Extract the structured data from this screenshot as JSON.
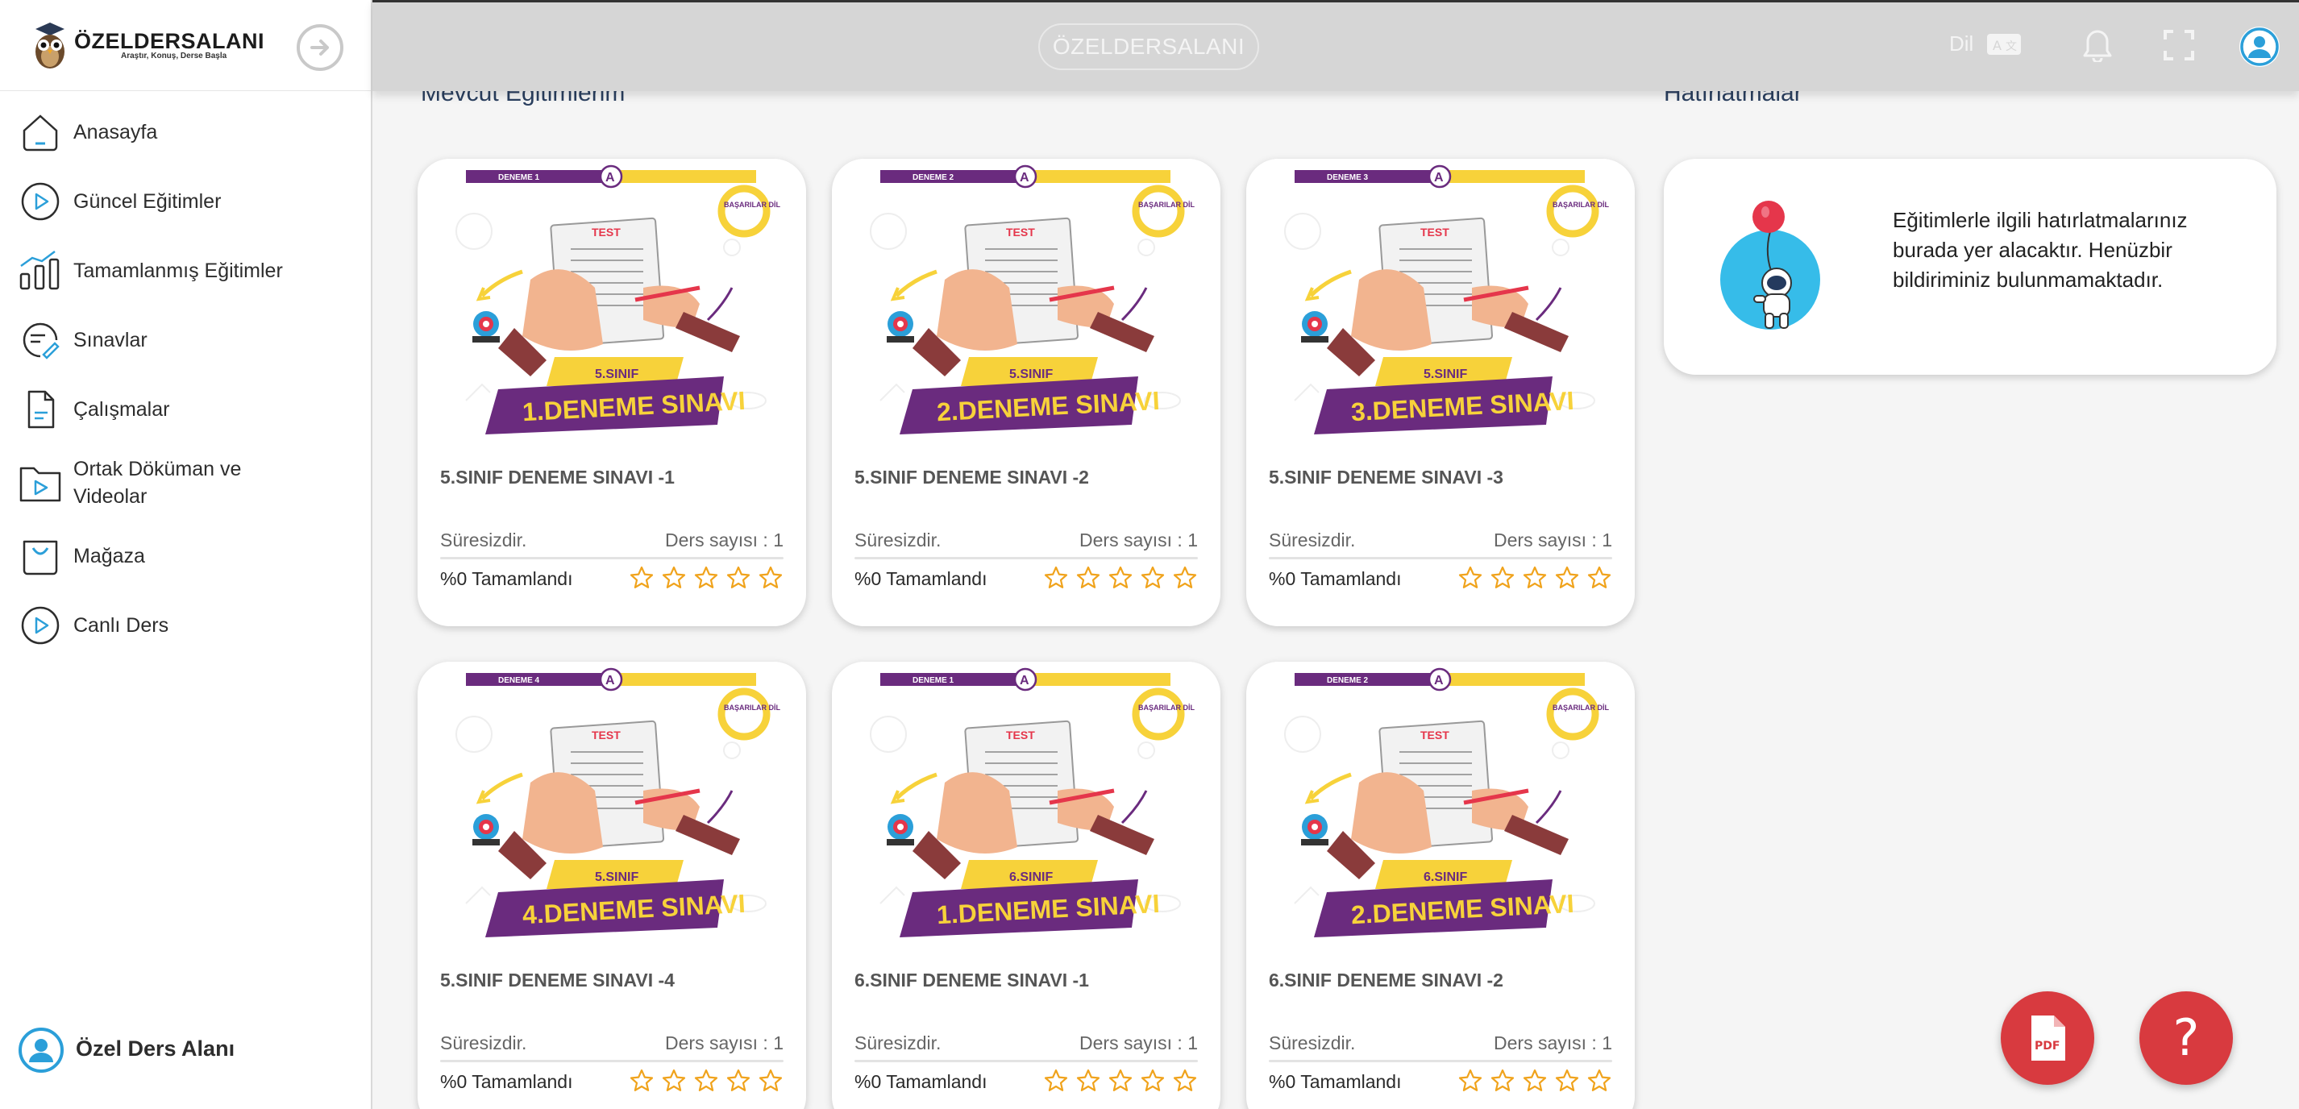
{
  "app": {
    "logo_title": "ÖZELDERSALANI",
    "logo_tagline": "Araştır, Konuş, Derse Başla",
    "brand_pill": "ÖZELDERSALANI"
  },
  "topbar": {
    "language_label": "Dil"
  },
  "sidebar": {
    "items": [
      {
        "label": "Anasayfa",
        "icon": "home-icon"
      },
      {
        "label": "Güncel Eğitimler",
        "icon": "play-circle-icon"
      },
      {
        "label": "Tamamlanmış Eğitimler",
        "icon": "bar-chart-icon"
      },
      {
        "label": "Sınavlar",
        "icon": "exam-icon"
      },
      {
        "label": "Çalışmalar",
        "icon": "document-icon"
      },
      {
        "label": "Ortak Döküman ve Videolar",
        "icon": "folder-play-icon"
      },
      {
        "label": "Mağaza",
        "icon": "shopping-bag-icon"
      },
      {
        "label": "Canlı Ders",
        "icon": "play-circle-icon"
      }
    ],
    "user_name": "Özel Ders Alanı"
  },
  "main": {
    "education_title": "Mevcut Eğitimlerim",
    "reminders_title": "Hatırlatmalar",
    "reminder_text": "Eğitimlerle ilgili hatırlatmalarınız burada yer alacaktır. Henüzbir bildiriminiz bulunmamaktadır.",
    "cards": [
      {
        "title": "5.SINIF DENEME SINAVI -1",
        "duration": "Süresizdir.",
        "lessons": "Ders sayısı : 1",
        "progress": "%0 Tamamlandı",
        "rating": 0,
        "img_top": "DENEME 1",
        "img_grade": "5.SINIF",
        "img_banner": "1.DENEME SINAVI",
        "img_badge": "A",
        "img_test": "TEST",
        "img_cloud": "BAŞARILAR DİLERİZ!"
      },
      {
        "title": "5.SINIF DENEME SINAVI -2",
        "duration": "Süresizdir.",
        "lessons": "Ders sayısı : 1",
        "progress": "%0 Tamamlandı",
        "rating": 0,
        "img_top": "DENEME 2",
        "img_grade": "5.SINIF",
        "img_banner": "2.DENEME SINAVI",
        "img_badge": "A",
        "img_test": "TEST",
        "img_cloud": "BAŞARILAR DİLERİZ!"
      },
      {
        "title": "5.SINIF DENEME SINAVI -3",
        "duration": "Süresizdir.",
        "lessons": "Ders sayısı : 1",
        "progress": "%0 Tamamlandı",
        "rating": 0,
        "img_top": "DENEME 3",
        "img_grade": "5.SINIF",
        "img_banner": "3.DENEME SINAVI",
        "img_badge": "A",
        "img_test": "TEST",
        "img_cloud": "BAŞARILAR DİLERİZ!"
      },
      {
        "title": "5.SINIF DENEME SINAVI -4",
        "duration": "Süresizdir.",
        "lessons": "Ders sayısı : 1",
        "progress": "%0 Tamamlandı",
        "rating": 0,
        "img_top": "DENEME 4",
        "img_grade": "5.SINIF",
        "img_banner": "4.DENEME SINAVI",
        "img_badge": "A",
        "img_test": "TEST",
        "img_cloud": "BAŞARILAR DİLERİZ!"
      },
      {
        "title": "6.SINIF DENEME SINAVI -1",
        "duration": "Süresizdir.",
        "lessons": "Ders sayısı : 1",
        "progress": "%0 Tamamlandı",
        "rating": 0,
        "img_top": "DENEME 1",
        "img_grade": "6.SINIF",
        "img_banner": "1.DENEME SINAVI",
        "img_badge": "A",
        "img_test": "TEST",
        "img_cloud": "BAŞARILAR DİLERİZ!"
      },
      {
        "title": "6.SINIF DENEME SINAVI -2",
        "duration": "Süresizdir.",
        "lessons": "Ders sayısı : 1",
        "progress": "%0 Tamamlandı",
        "rating": 0,
        "img_top": "DENEME 2",
        "img_grade": "6.SINIF",
        "img_banner": "2.DENEME SINAVI",
        "img_badge": "A",
        "img_test": "TEST",
        "img_cloud": "BAŞARILAR DİLERİZ!"
      }
    ]
  },
  "fabs": {
    "pdf_label": "PDF",
    "help_label": "?"
  },
  "colors": {
    "accent_blue": "#2b9fd9",
    "purple": "#6a2b7e",
    "yellow": "#f7d23a",
    "star_orange": "#f0a31c",
    "fab_red": "#d83a3f",
    "topbar": "#d6d6d6"
  }
}
